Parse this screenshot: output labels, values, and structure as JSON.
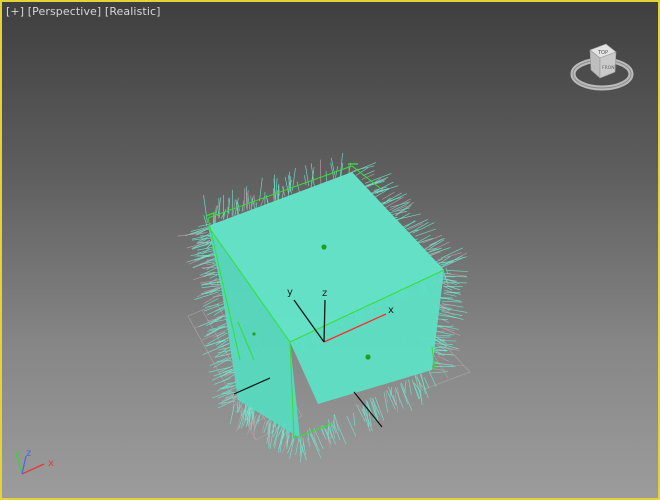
{
  "viewport": {
    "label_plus": "[+]",
    "label_view": "[Perspective]",
    "label_shading": "[Realistic]",
    "active_border_color": "#e3d33a"
  },
  "viewcube": {
    "face_top": "TOP",
    "face_front": "FRONT",
    "icon": "viewcube-icon"
  },
  "gizmo": {
    "x_label": "x",
    "y_label": "y",
    "z_label": "z"
  },
  "axis_triad": {
    "x_label": "x",
    "y_label": "y",
    "z_label": "z",
    "x_color": "#e23a3a",
    "y_color": "#3ad23a",
    "z_color": "#4a6ae0"
  },
  "object": {
    "fill_color": "#5fe0c4",
    "selection_color": "#33e033"
  }
}
